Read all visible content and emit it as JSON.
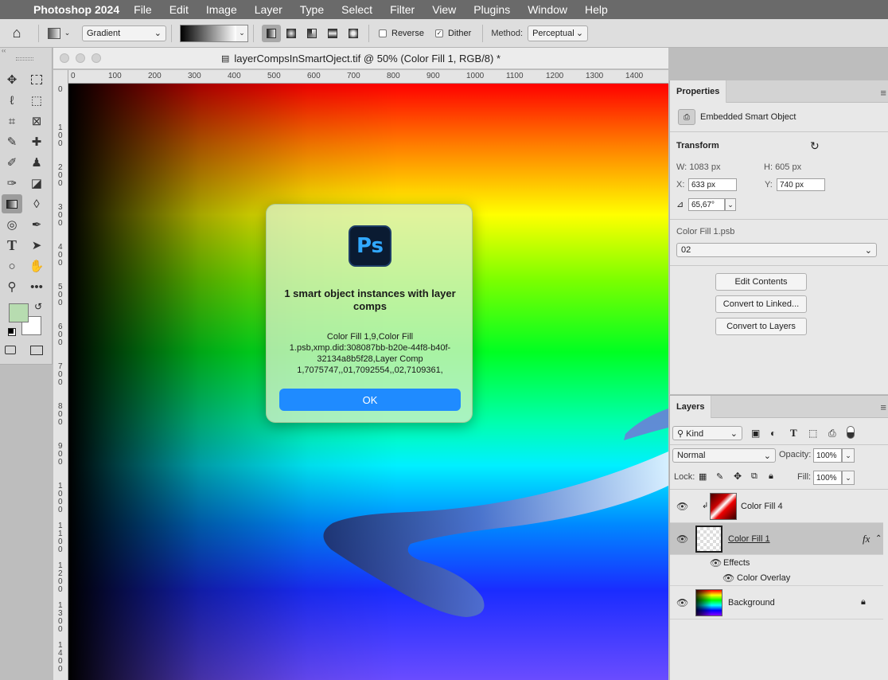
{
  "menubar": {
    "app_name": "Photoshop 2024",
    "items": [
      "File",
      "Edit",
      "Image",
      "Layer",
      "Type",
      "Select",
      "Filter",
      "View",
      "Plugins",
      "Window",
      "Help"
    ]
  },
  "options_bar": {
    "preset": "Gradient",
    "reverse_label": "Reverse",
    "reverse_checked": false,
    "dither_label": "Dither",
    "dither_checked": true,
    "method_label": "Method:",
    "method_value": "Perceptual"
  },
  "document": {
    "title": "layerCompsInSmartOject.tif @ 50% (Color Fill 1, RGB/8) *",
    "ruler_top": [
      "0",
      "100",
      "200",
      "300",
      "400",
      "500",
      "600",
      "700",
      "800",
      "900",
      "1000",
      "1100",
      "1200",
      "1300",
      "1400"
    ],
    "ruler_left": [
      "0",
      "1 0 0",
      "2 0 0",
      "3 0 0",
      "4 0 0",
      "5 0 0",
      "6 0 0",
      "7 0 0",
      "8 0 0",
      "9 0 0",
      "1 0 0 0",
      "1 1 0 0",
      "1 2 0 0",
      "1 3 0 0",
      "1 4 0 0"
    ]
  },
  "dialog": {
    "icon_text": "Ps",
    "title": "1 smart object instances with layer comps",
    "message": "Color Fill 1,9,Color Fill 1.psb,xmp.did:308087bb-b20e-44f8-b40f-32134a8b5f28,Layer Comp 1,7075747,,01,7092554,,02,7109361,",
    "ok_label": "OK"
  },
  "properties": {
    "tab": "Properties",
    "kind": "Embedded Smart Object",
    "transform_label": "Transform",
    "w_label": "W:",
    "w_value": "1083 px",
    "h_label": "H:",
    "h_value": "605 px",
    "x_label": "X:",
    "x_value": "633 px",
    "y_label": "Y:",
    "y_value": "740 px",
    "angle_value": "65,67°",
    "file_label": "Color Fill 1.psb",
    "comp_value": "02",
    "edit_contents": "Edit Contents",
    "convert_linked": "Convert to Linked...",
    "convert_layers": "Convert to Layers"
  },
  "layers": {
    "tab": "Layers",
    "filter_kind": "Kind",
    "blend_mode": "Normal",
    "opacity_label": "Opacity:",
    "opacity_value": "100%",
    "lock_label": "Lock:",
    "fill_label": "Fill:",
    "fill_value": "100%",
    "rows": [
      {
        "name": "Color Fill 4"
      },
      {
        "name": "Color Fill 1",
        "fx": "fx"
      },
      {
        "name": "Effects"
      },
      {
        "name": "Color Overlay"
      },
      {
        "name": "Background"
      }
    ]
  },
  "colors": {
    "foreground": "#b7dcb0",
    "background": "#ffffff",
    "ok_button": "#1f8bff",
    "selected_layer": "#c4c4c4"
  }
}
